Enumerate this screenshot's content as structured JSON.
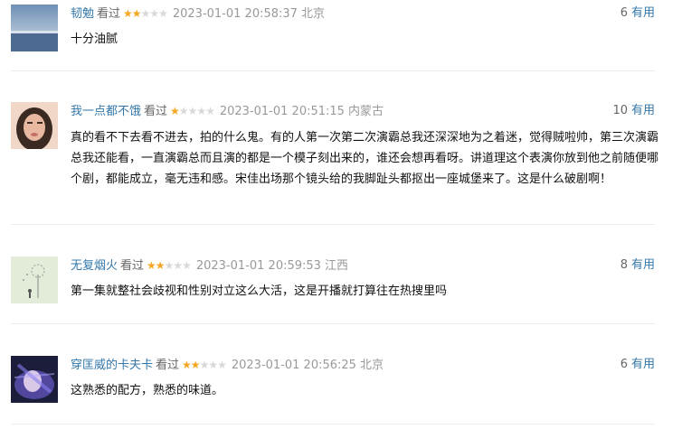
{
  "comments": [
    {
      "username": "韧勉",
      "watched_label": "看过",
      "rating": 2,
      "timestamp": "2023-01-01 20:58:37",
      "location": "北京",
      "votes": "6",
      "votes_label": "有用",
      "content": "十分油腻"
    },
    {
      "username": "我一点都不饿",
      "watched_label": "看过",
      "rating": 1,
      "timestamp": "2023-01-01 20:51:15",
      "location": "内蒙古",
      "votes": "10",
      "votes_label": "有用",
      "content": "真的看不下去看不进去，拍的什么鬼。有的人第一次第二次演霸总我还深深地为之着迷，觉得贼啦帅，第三次演霸总我还能看，一直演霸总而且演的都是一个模子刻出来的，谁还会想再看呀。讲道理这个表演你放到他之前随便哪个剧，都能成立，毫无违和感。宋佳出场那个镜头给的我脚趾头都抠出一座城堡来了。这是什么破剧啊！"
    },
    {
      "username": "无复烟火",
      "watched_label": "看过",
      "rating": 2,
      "timestamp": "2023-01-01 20:59:53",
      "location": "江西",
      "votes": "8",
      "votes_label": "有用",
      "content": "第一集就整社会歧视和性别对立这么大活，这是开播就打算往在热搜里吗"
    },
    {
      "username": "穿匡威的卡夫卡",
      "watched_label": "看过",
      "rating": 2,
      "timestamp": "2023-01-01 20:56:25",
      "location": "北京",
      "votes": "6",
      "votes_label": "有用",
      "content": "这熟悉的配方，熟悉的味道。"
    }
  ],
  "colors": {
    "username": "#3377aa",
    "star_on": "#f5a623",
    "star_off": "#d8d8d8",
    "meta_gray": "#999999"
  }
}
